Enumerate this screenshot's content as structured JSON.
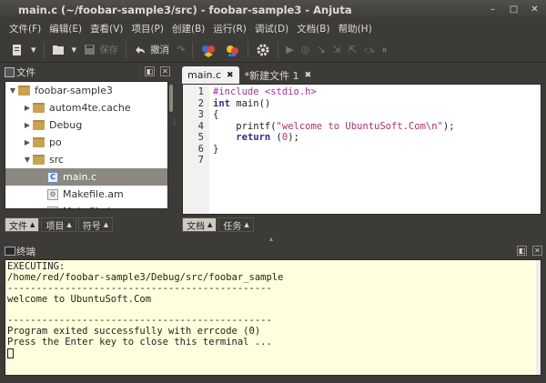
{
  "window": {
    "title": "main.c (~/foobar-sample3/src) - foobar-sample3 - Anjuta",
    "minimize": "–",
    "maximize": "□",
    "close": "✕"
  },
  "menu": [
    "文件(F)",
    "编辑(E)",
    "查看(V)",
    "项目(P)",
    "创建(B)",
    "运行(R)",
    "调试(D)",
    "文档(B)",
    "帮助(H)"
  ],
  "toolbar": {
    "save_label": "保存",
    "undo_label": "撤消"
  },
  "file_panel": {
    "title": "文件",
    "tree": [
      {
        "label": "foobar-sample3",
        "depth": 0,
        "arrow": "▼",
        "type": "folder"
      },
      {
        "label": "autom4te.cache",
        "depth": 1,
        "arrow": "▶",
        "type": "folder"
      },
      {
        "label": "Debug",
        "depth": 1,
        "arrow": "▶",
        "type": "folder"
      },
      {
        "label": "po",
        "depth": 1,
        "arrow": "▶",
        "type": "folder"
      },
      {
        "label": "src",
        "depth": 1,
        "arrow": "▼",
        "type": "folder"
      },
      {
        "label": "main.c",
        "depth": 2,
        "arrow": "",
        "type": "c",
        "selected": true
      },
      {
        "label": "Makefile.am",
        "depth": 2,
        "arrow": "",
        "type": "make"
      },
      {
        "label": "Makefile.in",
        "depth": 2,
        "arrow": "",
        "type": "make"
      }
    ],
    "tabs": [
      "文件",
      "项目",
      "符号"
    ]
  },
  "editor": {
    "tabs": [
      {
        "label": "main.c",
        "active": true
      },
      {
        "label": "*新建文件 1",
        "active": false
      }
    ],
    "line_numbers": [
      "1",
      "2",
      "3",
      "4",
      "5",
      "6",
      "7"
    ],
    "lines": [
      {
        "parts": [
          {
            "t": "#include <stdio.h>",
            "c": "pp"
          }
        ]
      },
      {
        "parts": [
          {
            "t": "int",
            "c": "kw"
          },
          {
            "t": " main()",
            "c": ""
          }
        ]
      },
      {
        "parts": [
          {
            "t": "{",
            "c": ""
          }
        ]
      },
      {
        "parts": [
          {
            "t": "    printf(",
            "c": ""
          },
          {
            "t": "\"welcome to UbuntuSoft.Com\\n\"",
            "c": "str"
          },
          {
            "t": ");",
            "c": ""
          }
        ]
      },
      {
        "parts": [
          {
            "t": "    ",
            "c": ""
          },
          {
            "t": "return",
            "c": "kw"
          },
          {
            "t": " (",
            "c": ""
          },
          {
            "t": "0",
            "c": "num"
          },
          {
            "t": ");",
            "c": ""
          }
        ]
      },
      {
        "parts": [
          {
            "t": "}",
            "c": ""
          }
        ]
      },
      {
        "parts": [
          {
            "t": "",
            "c": ""
          }
        ]
      }
    ],
    "bottom_tabs": [
      "文档",
      "任务"
    ]
  },
  "terminal": {
    "title": "终端",
    "lines": [
      "EXECUTING:",
      "/home/red/foobar-sample3/Debug/src/foobar_sample",
      "----------------------------------------------",
      "welcome to UbuntuSoft.Com",
      "",
      "----------------------------------------------",
      "Program exited successfully with errcode (0)",
      "Press the Enter key to close this terminal ..."
    ]
  }
}
